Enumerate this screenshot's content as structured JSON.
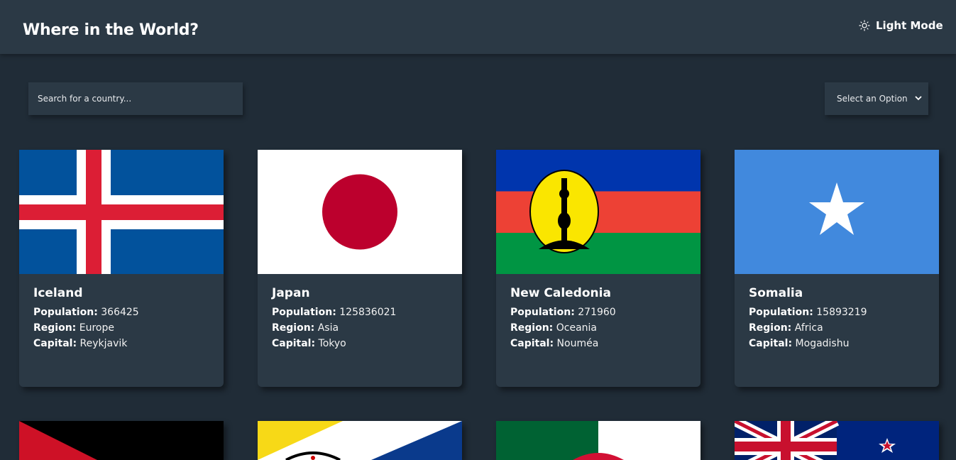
{
  "header": {
    "title": "Where in the World?",
    "mode_label": "Light Mode"
  },
  "search": {
    "placeholder": "Search for a country..."
  },
  "filter": {
    "selected": "Select an Option"
  },
  "labels": {
    "population": "Population:",
    "region": "Region:",
    "capital": "Capital:"
  },
  "colors": {
    "background": "#202c37",
    "elements": "#2b3945",
    "text": "#ffffff"
  },
  "countries": [
    {
      "name": "Iceland",
      "population": "366425",
      "region": "Europe",
      "capital": "Reykjavik",
      "flag": "iceland-flag"
    },
    {
      "name": "Japan",
      "population": "125836021",
      "region": "Asia",
      "capital": "Tokyo",
      "flag": "japan-flag"
    },
    {
      "name": "New Caledonia",
      "population": "271960",
      "region": "Oceania",
      "capital": "Nouméa",
      "flag": "new-caledonia-flag"
    },
    {
      "name": "Somalia",
      "population": "15893219",
      "region": "Africa",
      "capital": "Mogadishu",
      "flag": "somalia-flag"
    }
  ],
  "partial_cards": [
    {
      "flag": "red-black-triangle-flag"
    },
    {
      "flag": "yellow-white-blue-diagonal-flag"
    },
    {
      "flag": "green-white-flag"
    },
    {
      "flag": "new-zealand-flag"
    }
  ]
}
